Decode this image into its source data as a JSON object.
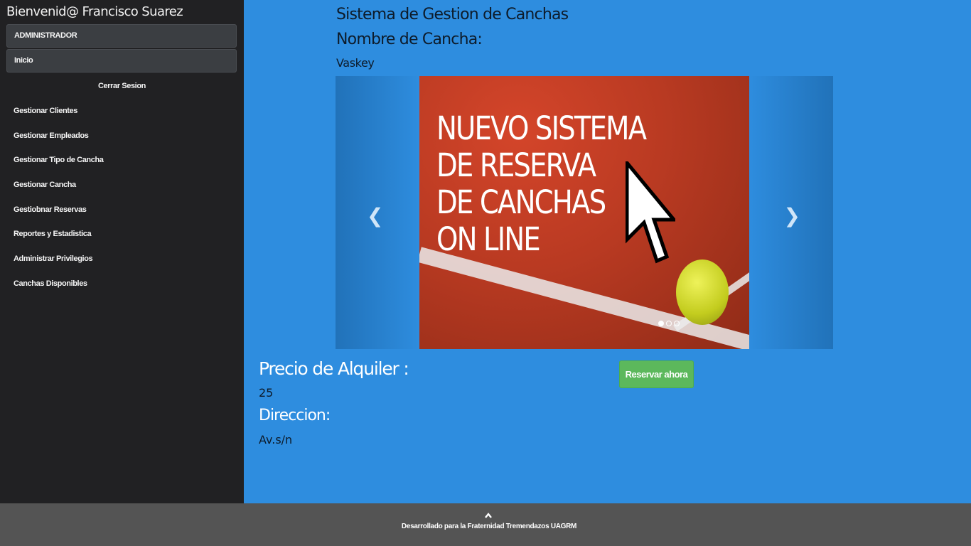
{
  "sidebar": {
    "welcome": "Bienvenid@ Francisco Suarez",
    "role_button": "ADMINISTRADOR",
    "home_button": "Inicio",
    "logout": "Cerrar Sesion",
    "items": [
      {
        "label": "Gestionar Clientes"
      },
      {
        "label": "Gestionar Empleados"
      },
      {
        "label": "Gestionar Tipo de Cancha"
      },
      {
        "label": "Gestionar Cancha"
      },
      {
        "label": "Gestiobnar Reservas"
      },
      {
        "label": "Reportes y Estadistica"
      },
      {
        "label": "Administrar Privilegios"
      },
      {
        "label": "Canchas Disponibles"
      }
    ]
  },
  "main": {
    "title": "Sistema de Gestion de Canchas",
    "name_label": "Nombre de Cancha:",
    "name_value": "Vaskey",
    "carousel": {
      "slide_text": "NUEVO SISTEMA\nDE RESERVA\nDE CANCHAS\nON LINE",
      "prev_icon": "chevron-left-icon",
      "next_icon": "chevron-right-icon",
      "indicator_count": 3,
      "active_index": 0
    },
    "price_label": "Precio de Alquiler :",
    "price_value": "25",
    "address_label": "Direccion:",
    "address_value": "Av.s/n",
    "reserve_button": "Reservar ahora"
  },
  "footer": {
    "text": "Desarrollado para la Fraternidad Tremendazos UAGRM",
    "icon": "chevron-up-icon"
  },
  "colors": {
    "background": "#2e8ddf",
    "sidebar": "#212123",
    "footer": "#545454",
    "reserve_button": "#5cb85c"
  }
}
